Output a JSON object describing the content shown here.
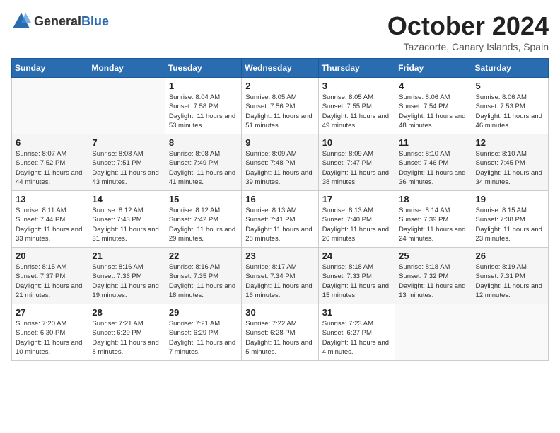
{
  "header": {
    "logo_general": "General",
    "logo_blue": "Blue",
    "title": "October 2024",
    "location": "Tazacorte, Canary Islands, Spain"
  },
  "days_of_week": [
    "Sunday",
    "Monday",
    "Tuesday",
    "Wednesday",
    "Thursday",
    "Friday",
    "Saturday"
  ],
  "weeks": [
    [
      {
        "day": "",
        "sunrise": "",
        "sunset": "",
        "daylight": "",
        "empty": true
      },
      {
        "day": "",
        "sunrise": "",
        "sunset": "",
        "daylight": "",
        "empty": true
      },
      {
        "day": "1",
        "sunrise": "Sunrise: 8:04 AM",
        "sunset": "Sunset: 7:58 PM",
        "daylight": "Daylight: 11 hours and 53 minutes."
      },
      {
        "day": "2",
        "sunrise": "Sunrise: 8:05 AM",
        "sunset": "Sunset: 7:56 PM",
        "daylight": "Daylight: 11 hours and 51 minutes."
      },
      {
        "day": "3",
        "sunrise": "Sunrise: 8:05 AM",
        "sunset": "Sunset: 7:55 PM",
        "daylight": "Daylight: 11 hours and 49 minutes."
      },
      {
        "day": "4",
        "sunrise": "Sunrise: 8:06 AM",
        "sunset": "Sunset: 7:54 PM",
        "daylight": "Daylight: 11 hours and 48 minutes."
      },
      {
        "day": "5",
        "sunrise": "Sunrise: 8:06 AM",
        "sunset": "Sunset: 7:53 PM",
        "daylight": "Daylight: 11 hours and 46 minutes."
      }
    ],
    [
      {
        "day": "6",
        "sunrise": "Sunrise: 8:07 AM",
        "sunset": "Sunset: 7:52 PM",
        "daylight": "Daylight: 11 hours and 44 minutes."
      },
      {
        "day": "7",
        "sunrise": "Sunrise: 8:08 AM",
        "sunset": "Sunset: 7:51 PM",
        "daylight": "Daylight: 11 hours and 43 minutes."
      },
      {
        "day": "8",
        "sunrise": "Sunrise: 8:08 AM",
        "sunset": "Sunset: 7:49 PM",
        "daylight": "Daylight: 11 hours and 41 minutes."
      },
      {
        "day": "9",
        "sunrise": "Sunrise: 8:09 AM",
        "sunset": "Sunset: 7:48 PM",
        "daylight": "Daylight: 11 hours and 39 minutes."
      },
      {
        "day": "10",
        "sunrise": "Sunrise: 8:09 AM",
        "sunset": "Sunset: 7:47 PM",
        "daylight": "Daylight: 11 hours and 38 minutes."
      },
      {
        "day": "11",
        "sunrise": "Sunrise: 8:10 AM",
        "sunset": "Sunset: 7:46 PM",
        "daylight": "Daylight: 11 hours and 36 minutes."
      },
      {
        "day": "12",
        "sunrise": "Sunrise: 8:10 AM",
        "sunset": "Sunset: 7:45 PM",
        "daylight": "Daylight: 11 hours and 34 minutes."
      }
    ],
    [
      {
        "day": "13",
        "sunrise": "Sunrise: 8:11 AM",
        "sunset": "Sunset: 7:44 PM",
        "daylight": "Daylight: 11 hours and 33 minutes."
      },
      {
        "day": "14",
        "sunrise": "Sunrise: 8:12 AM",
        "sunset": "Sunset: 7:43 PM",
        "daylight": "Daylight: 11 hours and 31 minutes."
      },
      {
        "day": "15",
        "sunrise": "Sunrise: 8:12 AM",
        "sunset": "Sunset: 7:42 PM",
        "daylight": "Daylight: 11 hours and 29 minutes."
      },
      {
        "day": "16",
        "sunrise": "Sunrise: 8:13 AM",
        "sunset": "Sunset: 7:41 PM",
        "daylight": "Daylight: 11 hours and 28 minutes."
      },
      {
        "day": "17",
        "sunrise": "Sunrise: 8:13 AM",
        "sunset": "Sunset: 7:40 PM",
        "daylight": "Daylight: 11 hours and 26 minutes."
      },
      {
        "day": "18",
        "sunrise": "Sunrise: 8:14 AM",
        "sunset": "Sunset: 7:39 PM",
        "daylight": "Daylight: 11 hours and 24 minutes."
      },
      {
        "day": "19",
        "sunrise": "Sunrise: 8:15 AM",
        "sunset": "Sunset: 7:38 PM",
        "daylight": "Daylight: 11 hours and 23 minutes."
      }
    ],
    [
      {
        "day": "20",
        "sunrise": "Sunrise: 8:15 AM",
        "sunset": "Sunset: 7:37 PM",
        "daylight": "Daylight: 11 hours and 21 minutes."
      },
      {
        "day": "21",
        "sunrise": "Sunrise: 8:16 AM",
        "sunset": "Sunset: 7:36 PM",
        "daylight": "Daylight: 11 hours and 19 minutes."
      },
      {
        "day": "22",
        "sunrise": "Sunrise: 8:16 AM",
        "sunset": "Sunset: 7:35 PM",
        "daylight": "Daylight: 11 hours and 18 minutes."
      },
      {
        "day": "23",
        "sunrise": "Sunrise: 8:17 AM",
        "sunset": "Sunset: 7:34 PM",
        "daylight": "Daylight: 11 hours and 16 minutes."
      },
      {
        "day": "24",
        "sunrise": "Sunrise: 8:18 AM",
        "sunset": "Sunset: 7:33 PM",
        "daylight": "Daylight: 11 hours and 15 minutes."
      },
      {
        "day": "25",
        "sunrise": "Sunrise: 8:18 AM",
        "sunset": "Sunset: 7:32 PM",
        "daylight": "Daylight: 11 hours and 13 minutes."
      },
      {
        "day": "26",
        "sunrise": "Sunrise: 8:19 AM",
        "sunset": "Sunset: 7:31 PM",
        "daylight": "Daylight: 11 hours and 12 minutes."
      }
    ],
    [
      {
        "day": "27",
        "sunrise": "Sunrise: 7:20 AM",
        "sunset": "Sunset: 6:30 PM",
        "daylight": "Daylight: 11 hours and 10 minutes."
      },
      {
        "day": "28",
        "sunrise": "Sunrise: 7:21 AM",
        "sunset": "Sunset: 6:29 PM",
        "daylight": "Daylight: 11 hours and 8 minutes."
      },
      {
        "day": "29",
        "sunrise": "Sunrise: 7:21 AM",
        "sunset": "Sunset: 6:29 PM",
        "daylight": "Daylight: 11 hours and 7 minutes."
      },
      {
        "day": "30",
        "sunrise": "Sunrise: 7:22 AM",
        "sunset": "Sunset: 6:28 PM",
        "daylight": "Daylight: 11 hours and 5 minutes."
      },
      {
        "day": "31",
        "sunrise": "Sunrise: 7:23 AM",
        "sunset": "Sunset: 6:27 PM",
        "daylight": "Daylight: 11 hours and 4 minutes."
      },
      {
        "day": "",
        "sunrise": "",
        "sunset": "",
        "daylight": "",
        "empty": true
      },
      {
        "day": "",
        "sunrise": "",
        "sunset": "",
        "daylight": "",
        "empty": true
      }
    ]
  ]
}
